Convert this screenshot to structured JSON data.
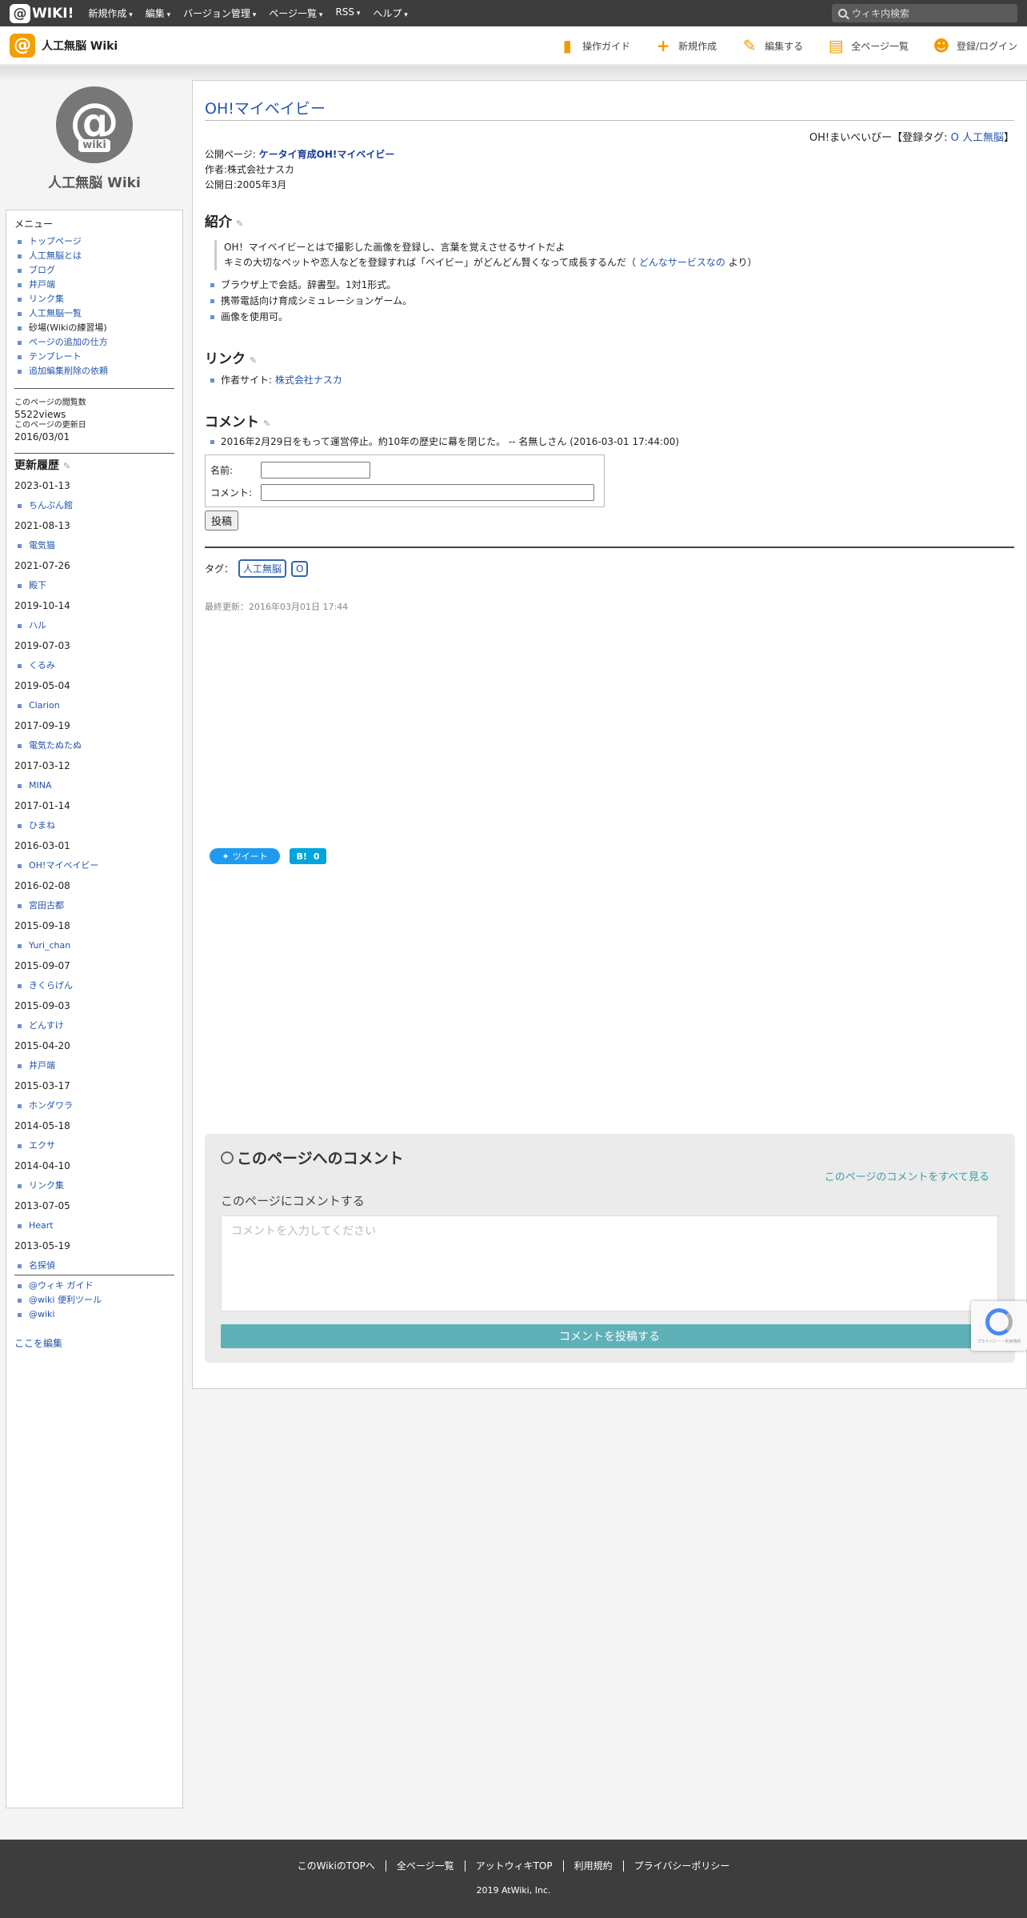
{
  "topbar": {
    "logo_text": "WIKI!",
    "menu": [
      "新規作成",
      "編集",
      "バージョン管理",
      "ページ一覧",
      "RSS",
      "ヘルプ"
    ],
    "search_placeholder": "ウィキ内検索"
  },
  "header": {
    "site_name": "人工無脳 Wiki",
    "actions": [
      "操作ガイド",
      "新規作成",
      "編集する",
      "全ページ一覧",
      "登録/ログイン"
    ]
  },
  "sidebar": {
    "site_name": "人工無脳 Wiki",
    "avatar_text": "wiki",
    "menu_title": "メニュー",
    "menu_items": [
      "トップページ",
      "人工無脳とは",
      "ブログ",
      "井戸端",
      "リンク集",
      "人工無脳一覧",
      "砂場(Wikiの練習場)",
      "ページの追加の仕方",
      "テンプレート",
      "追加編集削除の依頼"
    ],
    "views_label": "このページの閲覧数",
    "views_value": "5522views",
    "updated_label": "このページの更新日",
    "updated_value": "2016/03/01",
    "history_title": "更新履歴",
    "history": [
      {
        "date": "2023-01-13",
        "page": "ちんぷん館"
      },
      {
        "date": "2021-08-13",
        "page": "電気猫"
      },
      {
        "date": "2021-07-26",
        "page": "殿下"
      },
      {
        "date": "2019-10-14",
        "page": "ハル"
      },
      {
        "date": "2019-07-03",
        "page": "くるみ"
      },
      {
        "date": "2019-05-04",
        "page": "Clarion"
      },
      {
        "date": "2017-09-19",
        "page": "電気たぬたぬ"
      },
      {
        "date": "2017-03-12",
        "page": "MINA"
      },
      {
        "date": "2017-01-14",
        "page": "ひまね"
      },
      {
        "date": "2016-03-01",
        "page": "OH!マイベイビー"
      },
      {
        "date": "2016-02-08",
        "page": "宮田古都"
      },
      {
        "date": "2015-09-18",
        "page": "Yuri_chan"
      },
      {
        "date": "2015-09-07",
        "page": "きくらげん"
      },
      {
        "date": "2015-09-03",
        "page": "どんすけ"
      },
      {
        "date": "2015-04-20",
        "page": "井戸端"
      },
      {
        "date": "2015-03-17",
        "page": "ホンダワラ"
      },
      {
        "date": "2014-05-18",
        "page": "エクサ"
      },
      {
        "date": "2014-04-10",
        "page": "リンク集"
      },
      {
        "date": "2013-07-05",
        "page": "Heart"
      },
      {
        "date": "2013-05-19",
        "page": "名探偵"
      }
    ],
    "tools": [
      "@ウィキ ガイド",
      "@wiki 便利ツール",
      "@wiki"
    ],
    "edit_link": "ここを編集"
  },
  "main": {
    "title": "OH!マイベイビー",
    "tagline_prefix": "OH!まいべいびー【登録タグ: ",
    "tagline_tags": [
      "O",
      "人工無脳"
    ],
    "tagline_suffix": "】",
    "public_label": "公開ページ: ",
    "public_link": "ケータイ育成OH!マイベイビー",
    "author": "作者:株式会社ナスカ",
    "published": "公開日:2005年3月",
    "intro_heading": "紹介",
    "quote_line1": "OH！マイベイビーとはで撮影した画像を登録し、言葉を覚えさせるサイトだよ",
    "quote_line2_pre": "キミの大切なペットや恋人などを登録すれば「ベイビー」がどんどん賢くなって成長するんだ（",
    "quote_link": "どんなサービスなの",
    "quote_line2_post": "より）",
    "features": [
      "ブラウザ上で会話。辞書型。1対1形式。",
      "携帯電話向け育成シミュレーションゲーム。",
      "画像を使用可。"
    ],
    "links_heading": "リンク",
    "link_label": "作者サイト: ",
    "link_text": "株式会社ナスカ",
    "comment_heading": "コメント",
    "comments": [
      "2016年2月29日をもって運営停止。約10年の歴史に幕を閉じた。 -- 名無しさん (2016-03-01 17:44:00)"
    ],
    "form_name_label": "名前:",
    "form_comment_label": "コメント:",
    "post_button": "投稿",
    "tags_label": "タグ：",
    "tags": [
      "人工無脳",
      "O"
    ],
    "last_modified": "最終更新：2016年03月01日 17:44",
    "tweet_label": "ツイート",
    "hatena_label": "B!",
    "hatena_count": "0"
  },
  "page_comments": {
    "title": "このページへのコメント",
    "view_all": "このページのコメントをすべて見る",
    "subtitle": "このページにコメントする",
    "placeholder": "コメントを入力してください",
    "submit": "コメントを投稿する",
    "recaptcha_text": "プライバシー・利用規約"
  },
  "footer": {
    "links": [
      "このWikiのTOPへ",
      "全ページ一覧",
      "アットウィキTOP",
      "利用規約",
      "プライバシーポリシー"
    ],
    "copyright": "2019 AtWiki, Inc."
  },
  "colors": {
    "accent": "#f29a00",
    "link": "#2255aa",
    "topbar": "#3d3d3d",
    "comment_button": "#5fb1b8"
  }
}
